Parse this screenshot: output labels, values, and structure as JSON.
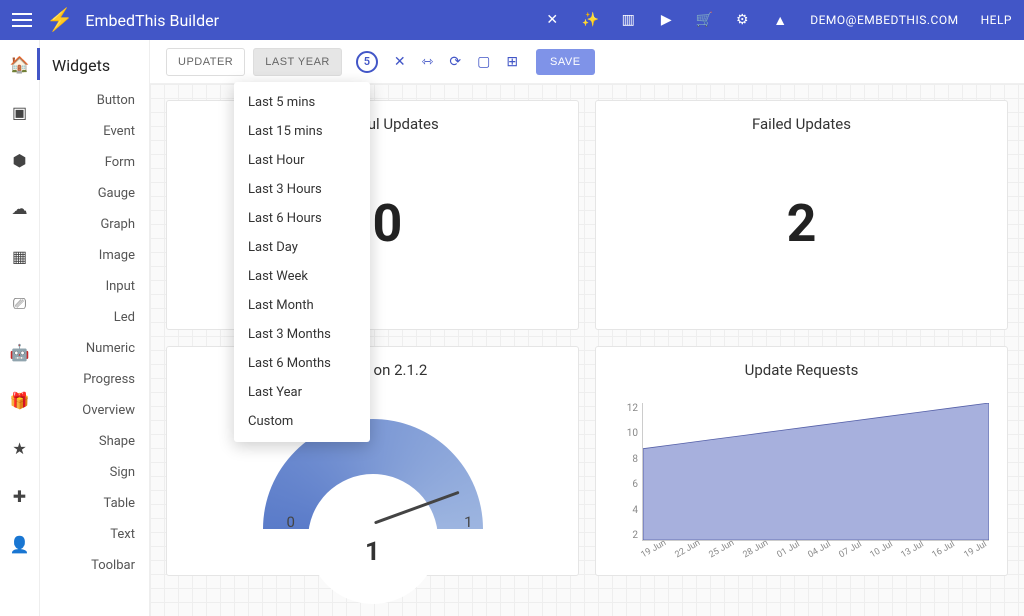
{
  "app": {
    "name": "EmbedThis Builder",
    "user": "DEMO@EMBEDTHIS.COM",
    "help": "HELP"
  },
  "rail_icons": [
    "home",
    "dashboard",
    "cube",
    "cloud",
    "grid",
    "device",
    "robot",
    "gift",
    "star",
    "plus",
    "user"
  ],
  "widgets": {
    "title": "Widgets",
    "items": [
      "Button",
      "Event",
      "Form",
      "Gauge",
      "Graph",
      "Image",
      "Input",
      "Led",
      "Numeric",
      "Progress",
      "Overview",
      "Shape",
      "Sign",
      "Table",
      "Text",
      "Toolbar"
    ]
  },
  "toolbar": {
    "updater": "UPDATER",
    "range_button": "LAST YEAR",
    "badge": "5",
    "save": "SAVE"
  },
  "dropdown": [
    "Last 5 mins",
    "Last 15 mins",
    "Last Hour",
    "Last 3 Hours",
    "Last 6 Hours",
    "Last Day",
    "Last Week",
    "Last Month",
    "Last 3 Months",
    "Last 6 Months",
    "Last Year",
    "Custom"
  ],
  "cards": {
    "successful": {
      "title": "Successful Updates",
      "value": "10"
    },
    "failed": {
      "title": "Failed Updates",
      "value": "2"
    },
    "devices": {
      "title": "Devices on 2.1.2",
      "min": "0",
      "max": "1",
      "value": "1"
    },
    "requests": {
      "title": "Update Requests"
    }
  },
  "chart_data": {
    "type": "area",
    "title": "Update Requests",
    "x": [
      "19 Jun",
      "22 Jun",
      "25 Jun",
      "28 Jun",
      "01 Jul",
      "04 Jul",
      "07 Jul",
      "10 Jul",
      "13 Jul",
      "16 Jul",
      "19 Jul"
    ],
    "y": [
      8,
      8.4,
      8.8,
      9.2,
      9.6,
      10.0,
      10.4,
      10.8,
      11.2,
      11.6,
      12
    ],
    "ylabel": "",
    "ylim": [
      0,
      12
    ],
    "yticks": [
      12,
      10,
      8,
      6,
      4,
      2
    ]
  }
}
